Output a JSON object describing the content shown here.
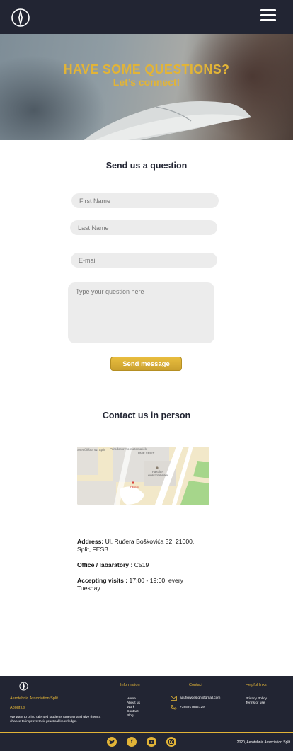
{
  "nav": {
    "logo": "aerotehnic-logo-icon",
    "menu": "hamburger-menu-icon"
  },
  "hero": {
    "title": "HAVE SOME QUESTIONS?",
    "subtitle": "Let’s connect!"
  },
  "form": {
    "title": "Send us a question",
    "first_name_placeholder": "First Name",
    "last_name_placeholder": "Last Name",
    "email_placeholder": "E-mail",
    "question_placeholder": "Type your question here",
    "send_label": "Send message"
  },
  "contact": {
    "title": "Contact us in person",
    "map_labels": [
      "Sveučilišna sv. Split",
      "Prirodoslovno-matematički",
      "PMF SPLIT",
      "Fakultet",
      "elektrotehnike",
      "FESB"
    ],
    "address_label": "Address:",
    "address_value": "Ul. Ruđera Boškovića 32, 21000, Split, FESB",
    "office_label": "Office / labaratory :",
    "office_value": "C519",
    "visits_label": "Accepting visits :",
    "visits_value": "17:00 - 19:00, every Tuesday"
  },
  "footer": {
    "org_name": "Aerotehnic Association Split",
    "about_heading": "About us",
    "about_text": "We want to bring talented students together and give them a chance to improve their practical knowledge.",
    "information_heading": "Information",
    "information_links": [
      "Home",
      "About us",
      "Work",
      "Contact",
      "Blog"
    ],
    "contact_heading": "Contact",
    "email": "aaufiowdesign@gmail.com",
    "phone": "+385917962729",
    "helpful_heading": "Helpful links",
    "helpful_links": [
      "Privacy Policy",
      "Terms of use"
    ],
    "social_icons": [
      "twitter-icon",
      "facebook-icon",
      "youtube-icon",
      "instagram-icon"
    ],
    "copyright": "2020, Aerotehnic Association Split"
  },
  "colors": {
    "navy": "#222533",
    "gold": "#e2b437",
    "field": "#ececec"
  }
}
